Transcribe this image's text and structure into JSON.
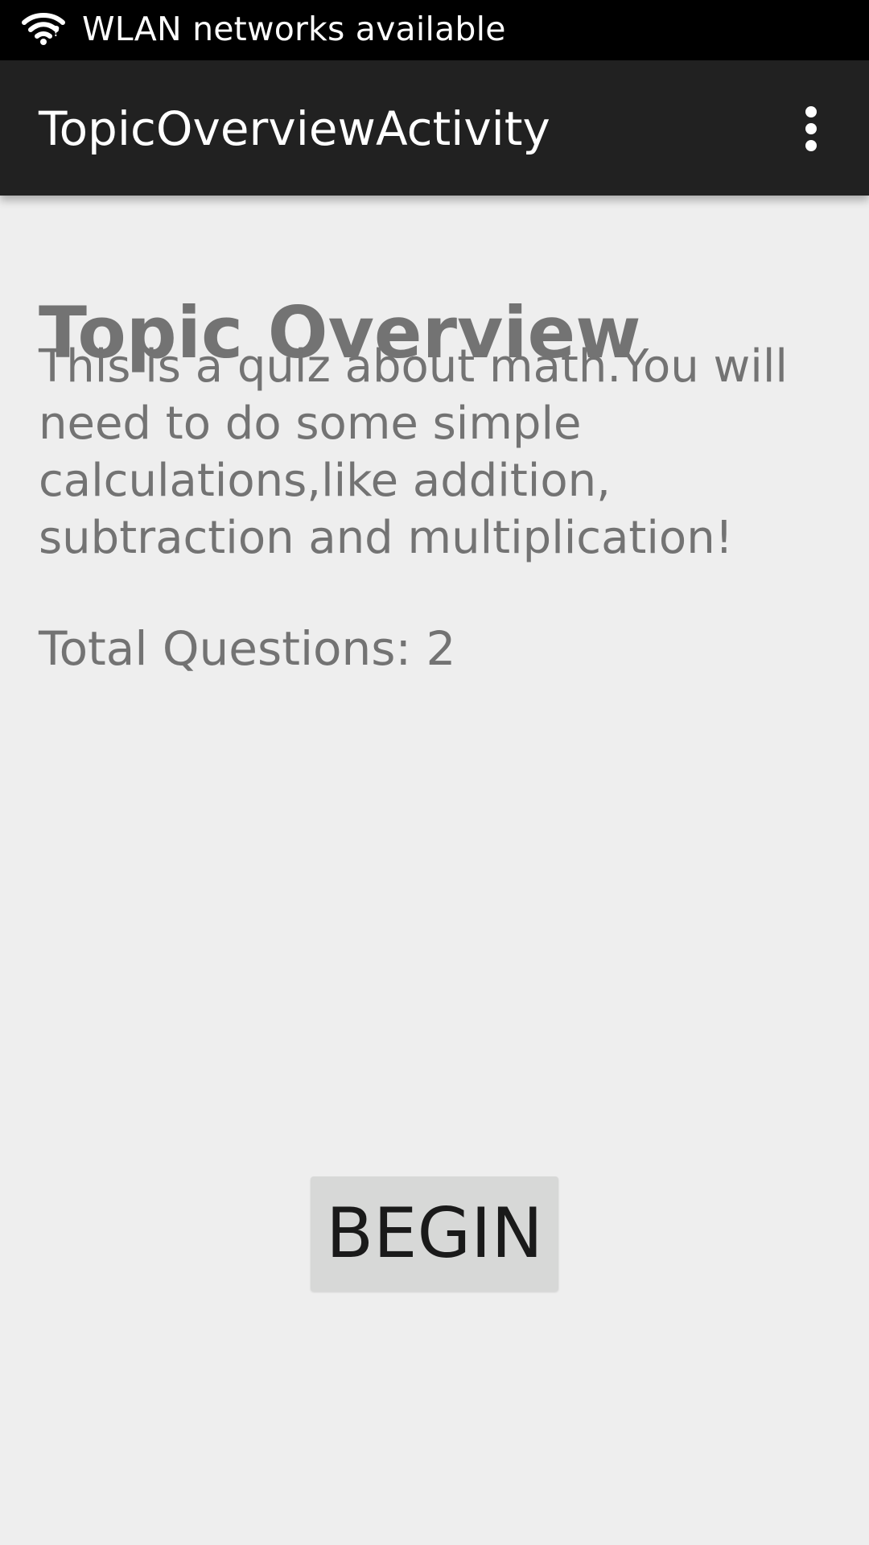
{
  "status_bar": {
    "icon": "wifi-notification-icon",
    "text": "WLAN networks available"
  },
  "app_bar": {
    "title": "TopicOverviewActivity",
    "menu_icon": "overflow-menu-icon"
  },
  "topic": {
    "heading": "Topic Overview",
    "description_lines": [
      "This is a quiz about math.You will",
      "need to do some simple",
      "calculations,like addition,",
      "subtraction and multiplication!"
    ],
    "total_questions": "Total Questions: 2"
  },
  "actions": {
    "begin_label": "BEGIN"
  },
  "colors": {
    "status_bar": "#000000",
    "app_bar": "#212121",
    "background": "#eeeeee",
    "content_text": "#737373",
    "button": "#d7d8d7",
    "button_text": "#1a1a1a"
  }
}
